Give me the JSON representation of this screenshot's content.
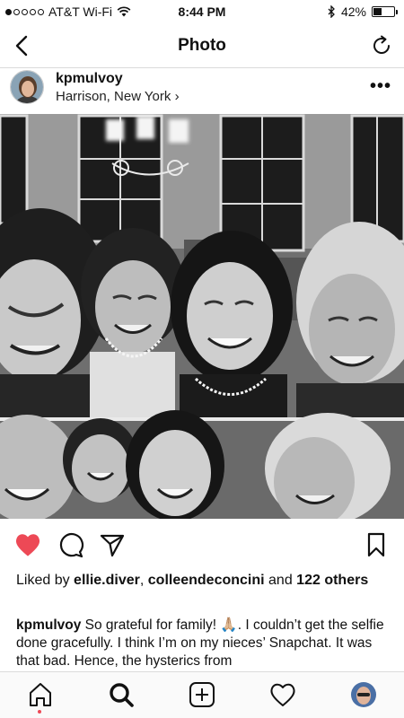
{
  "status_bar": {
    "carrier": "AT&T Wi-Fi",
    "time": "8:44 PM",
    "battery": "42%",
    "battery_level": 0.42,
    "signal_bars": 1
  },
  "nav": {
    "title": "Photo",
    "back_icon": "chevron-left-icon",
    "refresh_icon": "refresh-icon"
  },
  "post": {
    "username": "kpmulvoy",
    "location": "Harrison, New York",
    "location_chevron": "›",
    "more": "•••"
  },
  "likes": {
    "prefix": "Liked by ",
    "user1": "ellie.diver",
    "sep": ", ",
    "user2": "colleendeconcini",
    "and": " and ",
    "others": "122 others"
  },
  "caption": {
    "username": "kpmulvoy",
    "text": " So grateful for family! 🙏🏼. I couldn’t get the selfie done gracefully. I think I’m on my nieces’ Snapchat. It was that bad. Hence, the hysterics from"
  },
  "colors": {
    "like_red": "#ed4956",
    "divider": "#dbdbdb"
  },
  "tabs": [
    "home-icon",
    "search-icon",
    "add-icon",
    "heart-icon",
    "profile-icon"
  ]
}
